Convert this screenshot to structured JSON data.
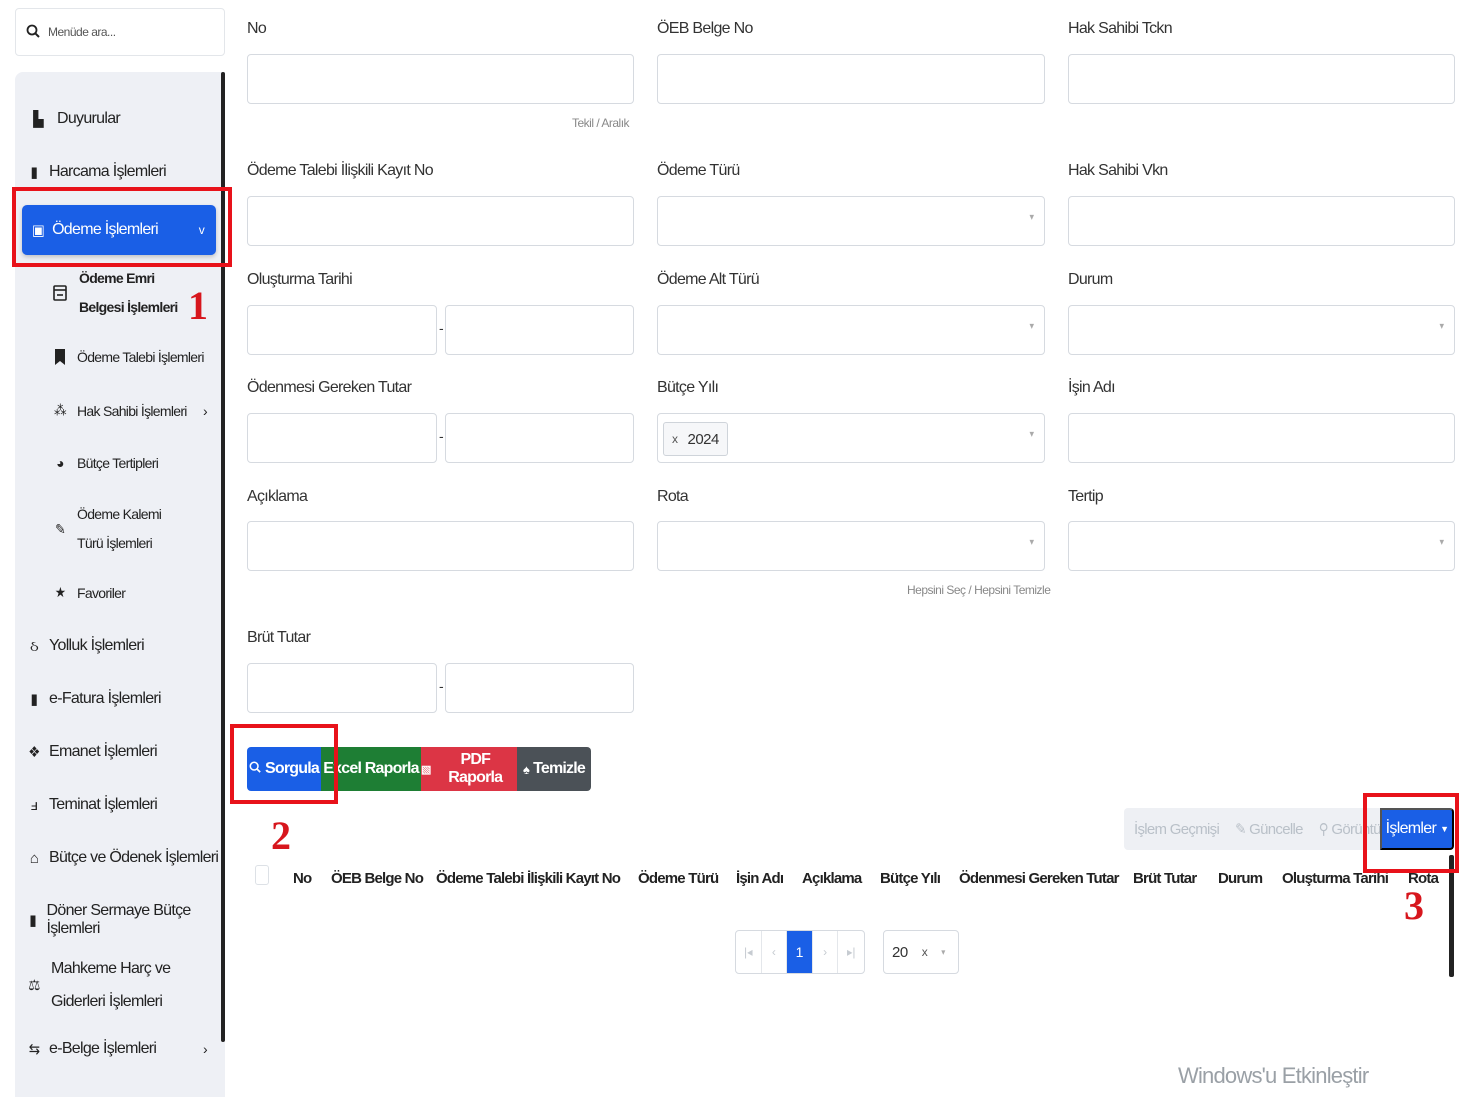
{
  "search": {
    "placeholder": "Menüde ara..."
  },
  "sidebar": {
    "items": [
      {
        "label": "Duyurular",
        "icon": "book-icon"
      },
      {
        "label": "Harcama İşlemleri",
        "icon": "receipt-icon"
      },
      {
        "label": "Ödeme İşlemleri",
        "icon": "money-icon",
        "active": true
      },
      {
        "label": "Ödeme Emri Belgesi İşlemleri",
        "icon": "document-list-icon",
        "sub": true,
        "current": true
      },
      {
        "label": "Ödeme Talebi İşlemleri",
        "icon": "bookmark-icon",
        "sub": true
      },
      {
        "label": "Hak Sahibi İşlemleri",
        "icon": "sitemap-icon",
        "sub": true
      },
      {
        "label": "Bütçe Tertipleri",
        "icon": "pie-chart-icon",
        "sub": true
      },
      {
        "label": "Ödeme Kalemi Türü İşlemleri",
        "icon": "pen-icon",
        "sub": true
      },
      {
        "label": "Favoriler",
        "icon": "star-icon",
        "sub": true
      },
      {
        "label": "Yolluk İşlemleri",
        "icon": "route-icon"
      },
      {
        "label": "e-Fatura İşlemleri",
        "icon": "invoice-icon"
      },
      {
        "label": "Emanet İşlemleri",
        "icon": "dropbox-icon"
      },
      {
        "label": "Teminat İşlemleri",
        "icon": "hand-holding-icon"
      },
      {
        "label": "Bütçe ve Ödenek İşlemleri",
        "icon": "bank-icon"
      },
      {
        "label": "Döner Sermaye Bütçe İşlemleri",
        "icon": "book-dark-icon"
      },
      {
        "label": "Mahkeme Harç ve Giderleri İşlemleri",
        "icon": "scale-icon"
      },
      {
        "label": "e-Belge İşlemleri",
        "icon": "file-transfer-icon"
      }
    ]
  },
  "form": {
    "no_label": "No",
    "no_hint_tekil": "Tekil",
    "no_hint_sep": "/",
    "no_hint_aralik": "Aralık",
    "oeb_label": "ÖEB Belge No",
    "tckn_label": "Hak Sahibi Tckn",
    "talep_label": "Ödeme Talebi İlişkili Kayıt No",
    "odeme_turu_label": "Ödeme Türü",
    "vkn_label": "Hak Sahibi Vkn",
    "olusturma_label": "Oluşturma Tarihi",
    "alt_tur_label": "Ödeme Alt Türü",
    "durum_label": "Durum",
    "tutar_label": "Ödenmesi Gereken Tutar",
    "butce_yili_label": "Bütçe Yılı",
    "butce_yili_value": "2024",
    "isin_adi_label": "İşin Adı",
    "aciklama_label": "Açıklama",
    "rota_label": "Rota",
    "rota_hint_sec": "Hepsini Seç",
    "rota_hint_sep": "/",
    "rota_hint_temizle": "Hepsini Temizle",
    "tertip_label": "Tertip",
    "brut_label": "Brüt Tutar",
    "range_dash": "-"
  },
  "buttons": {
    "sorgula": "Sorgula",
    "excel": "Excel Raporla",
    "pdf": "PDF Raporla",
    "temizle": "Temizle"
  },
  "toolbar": {
    "gecmis": "İşlem Geçmişi",
    "guncelle": "Güncelle",
    "goruntule": "Görüntü",
    "islemler": "İşlemler"
  },
  "table": {
    "columns": [
      "No",
      "ÖEB Belge No",
      "Ödeme Talebi İlişkili Kayıt No",
      "Ödeme Türü",
      "İşin Adı",
      "Açıklama",
      "Bütçe Yılı",
      "Ödenmesi Gereken Tutar",
      "Brüt Tutar",
      "Durum",
      "Oluşturma Tarihi",
      "Rota"
    ]
  },
  "pagination": {
    "current_page": "1",
    "page_size": "20"
  },
  "annotations": {
    "n1": "1",
    "n2": "2",
    "n3": "3"
  },
  "watermark": "Windows'u Etkinleştir",
  "colors": {
    "primary": "#1a5fe6",
    "success": "#1e7e34",
    "danger": "#dc3545",
    "dark": "#4b5157",
    "annotation_red": "#e8121a"
  }
}
